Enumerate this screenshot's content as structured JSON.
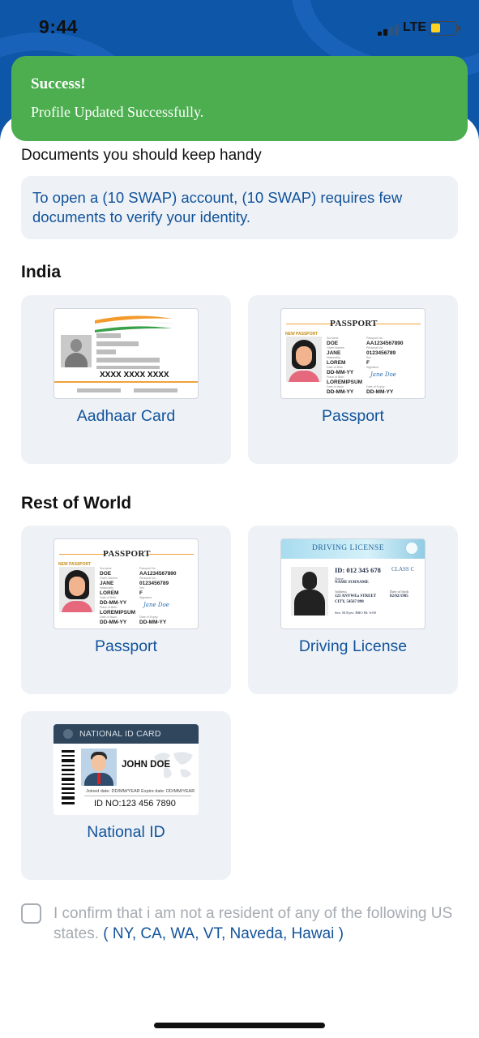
{
  "status_bar": {
    "time": "9:44",
    "network": "LTE"
  },
  "toast": {
    "title": "Success!",
    "message": "Profile Updated Successfully."
  },
  "documents": {
    "heading": "Documents you should keep handy",
    "info": "To open a (10 SWAP) account, (10 SWAP) requires few documents to verify your identity."
  },
  "sections": {
    "india": {
      "title": "India",
      "cards": [
        {
          "label": "Aadhaar Card"
        },
        {
          "label": "Passport"
        }
      ]
    },
    "rest_of_world": {
      "title": "Rest of World",
      "cards": [
        {
          "label": "Passport"
        },
        {
          "label": "Driving License"
        },
        {
          "label": "National ID"
        }
      ]
    }
  },
  "aadhaar_thumb": {
    "number": "XXXX XXXX XXXX"
  },
  "passport_thumb": {
    "header": "PASSPORT",
    "tag": "NEW PASSPORT",
    "surname": "DOE",
    "given_name": "JANE",
    "nationality": "LOREM",
    "dob": "DD-MM-YY",
    "place": "LOREMIPSUM",
    "issued": "DD-MM-YY",
    "passport_no": "AA1234567890",
    "personal_no": "0123456789",
    "sex": "F",
    "signature": "Jane Doe",
    "expiry": "DD-MM-YY",
    "lbl_surname": "Surname",
    "lbl_given": "Given Names",
    "lbl_nation": "Nationality",
    "lbl_dob": "Date of Birth",
    "lbl_place": "Place of Birth",
    "lbl_issue": "Date of Issue",
    "lbl_pno": "Passport No.",
    "lbl_persno": "Personal No.",
    "lbl_sex": "Sex",
    "lbl_sign": "Signature",
    "lbl_exp": "Date of Expiry"
  },
  "dl_thumb": {
    "title": "DRIVING LICENSE",
    "id": "ID: 012 345 678",
    "class": "CLASS C",
    "name_label": "Name",
    "name": "NAME SURNAME",
    "address_label": "Address",
    "address_line1": "123 ANYWEa STREET",
    "address_line2": "CITY, 54567 890",
    "dob_label": "Date of birth",
    "dob": "02/02/1985",
    "footer": "Sex: M   Eyes: BRO   Ht: 6-00"
  },
  "nid_thumb": {
    "title": "NATIONAL ID CARD",
    "name": "JOHN DOE",
    "dates": "Joined date: DD/MM/YEAR    Expire date: DD/MM/YEAR",
    "id_no": "ID NO:123 456 7890"
  },
  "confirm": {
    "text": "I confirm that i am not a resident of any of the following US states.",
    "states": "( NY, CA, WA, VT, Naveda, Hawai )"
  },
  "colors": {
    "brand_blue": "#0e56a8",
    "link_blue": "#12539a",
    "success_green": "#4cae4f",
    "card_bg": "#eef2f7"
  }
}
